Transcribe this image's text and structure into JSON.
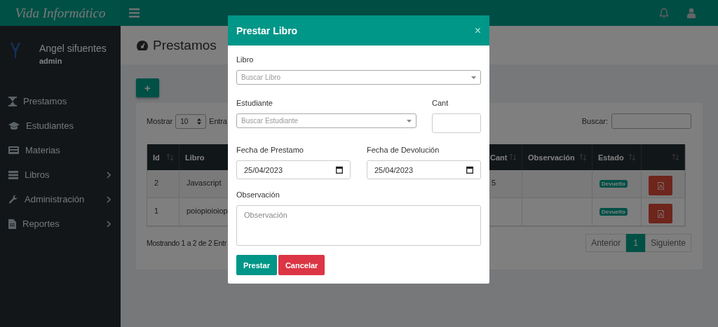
{
  "brand": "Vida Informático",
  "user": {
    "name": "Angel sifuentes",
    "role": "admin"
  },
  "sidebar": {
    "items": [
      {
        "label": "Prestamos",
        "expandable": false
      },
      {
        "label": "Estudiantes",
        "expandable": false
      },
      {
        "label": "Materias",
        "expandable": false
      },
      {
        "label": "Libros",
        "expandable": true
      },
      {
        "label": "Administración",
        "expandable": true
      },
      {
        "label": "Reportes",
        "expandable": true
      }
    ]
  },
  "page": {
    "title": "Prestamos",
    "add_button": "+",
    "length_label": "Mostrar",
    "length_value": "10",
    "length_suffix": "Entra",
    "search_label": "Buscar:"
  },
  "table": {
    "columns": [
      "Id",
      "Libro",
      "Cant",
      "Observación",
      "Estado"
    ],
    "rows": [
      {
        "id": "2",
        "libro": "Javascript",
        "cant": "5",
        "estado": "Devuelto"
      },
      {
        "id": "1",
        "libro": "poiopioioiop",
        "estado": "Devuelto"
      }
    ]
  },
  "table_info": "Mostrando 1 a 2 de 2 Entr",
  "pagination": [
    {
      "label": "Anterior",
      "selected": false
    },
    {
      "label": "1",
      "selected": true
    },
    {
      "label": "Siguiente",
      "selected": false
    }
  ],
  "modal": {
    "title": "Prestar Libro",
    "close": "×",
    "libro": {
      "label": "Libro",
      "placeholder": "Buscar Libro"
    },
    "estudiante": {
      "label": "Estudiante",
      "placeholder": "Buscar Estudiante"
    },
    "cant": {
      "label": "Cant"
    },
    "fecha_prestamo": {
      "label": "Fecha de Prestamo",
      "value": "25/04/2023"
    },
    "fecha_devolucion": {
      "label": "Fecha de Devolución",
      "value": "25/04/2023"
    },
    "observacion": {
      "label": "Observación",
      "placeholder": "Observación"
    },
    "buttons": [
      "Prestar",
      "Cancelar"
    ]
  }
}
